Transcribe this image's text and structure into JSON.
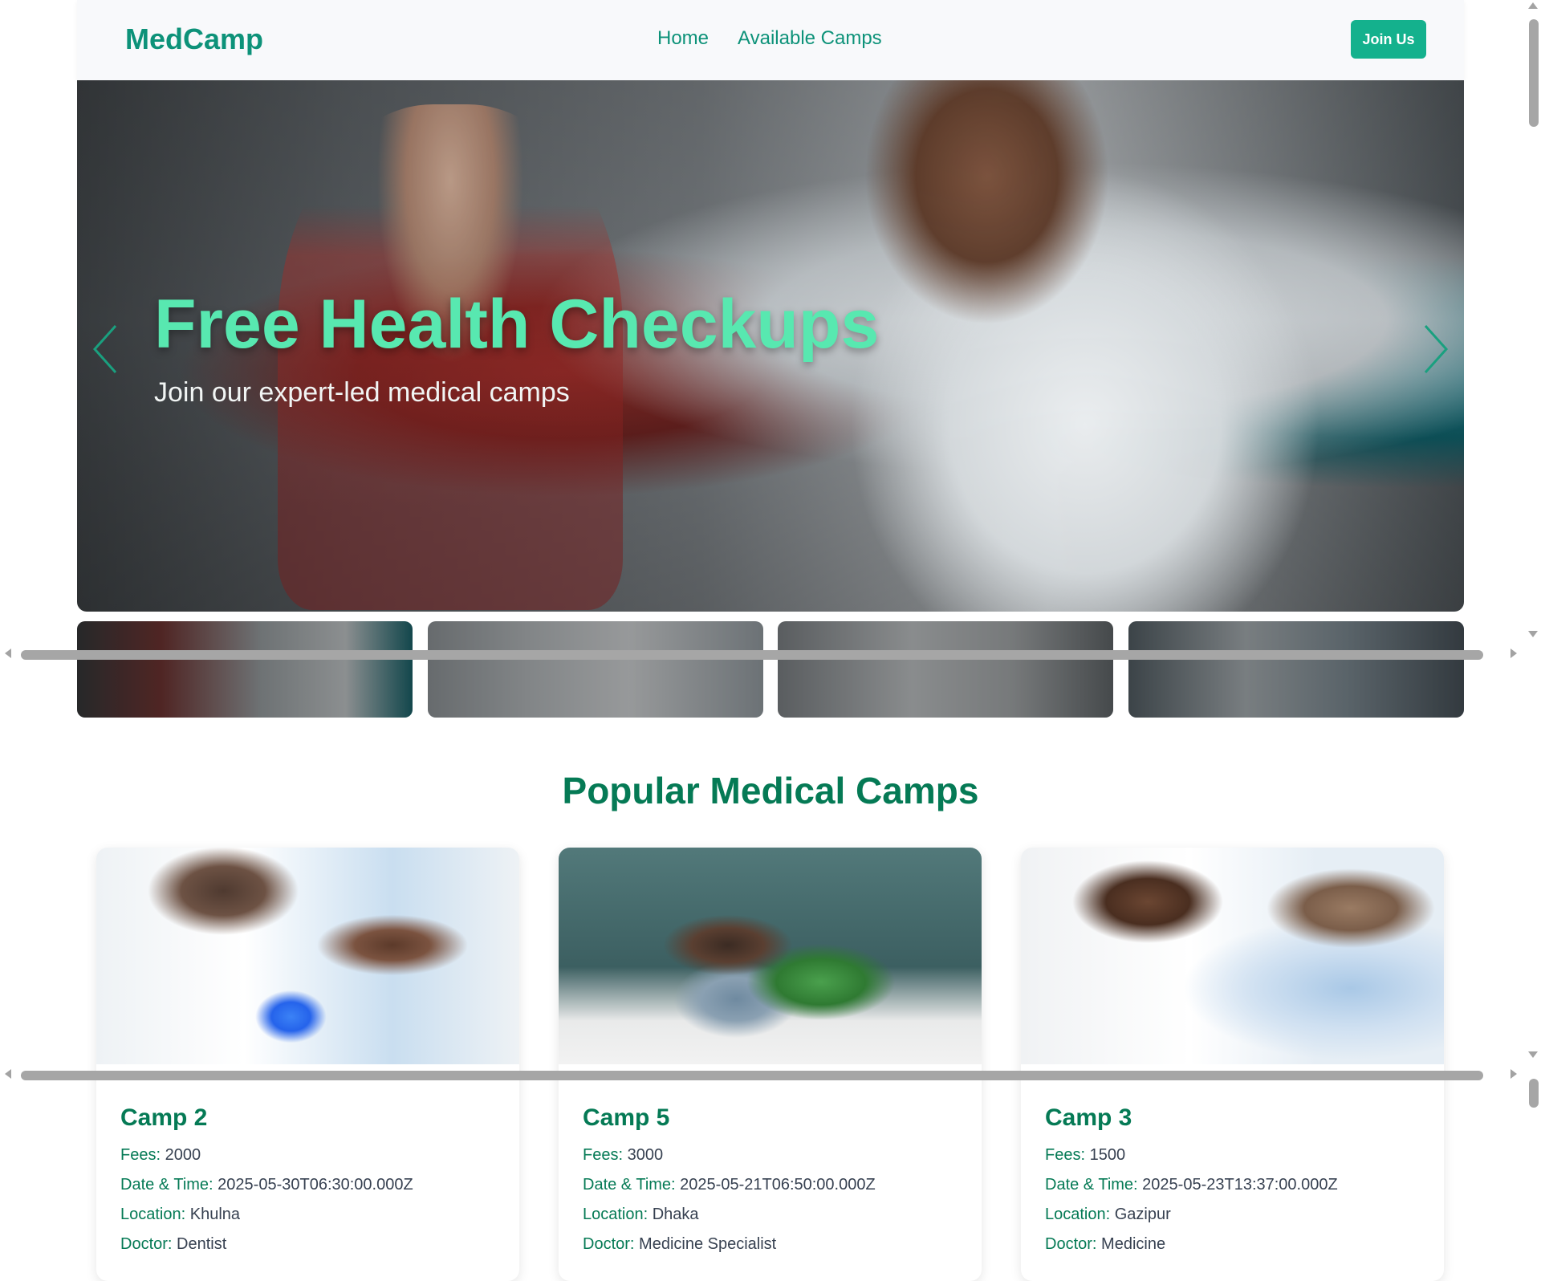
{
  "nav": {
    "brand": "MedCamp",
    "links": [
      "Home",
      "Available Camps"
    ],
    "join_label": "Join Us"
  },
  "hero": {
    "title": "Free Health Checkups",
    "subtitle": "Join our expert-led medical camps"
  },
  "section": {
    "title": "Popular Medical Camps"
  },
  "camps": [
    {
      "name": "Camp 2",
      "fees_label": "Fees:",
      "fees": "2000",
      "datetime_label": "Date & Time:",
      "datetime": "2025-05-30T06:30:00.000Z",
      "location_label": "Location:",
      "location": "Khulna",
      "doctor_label": "Doctor:",
      "doctor": "Dentist"
    },
    {
      "name": "Camp 5",
      "fees_label": "Fees:",
      "fees": "3000",
      "datetime_label": "Date & Time:",
      "datetime": "2025-05-21T06:50:00.000Z",
      "location_label": "Location:",
      "location": "Dhaka",
      "doctor_label": "Doctor:",
      "doctor": "Medicine Specialist"
    },
    {
      "name": "Camp 3",
      "fees_label": "Fees:",
      "fees": "1500",
      "datetime_label": "Date & Time:",
      "datetime": "2025-05-23T13:37:00.000Z",
      "location_label": "Location:",
      "location": "Gazipur",
      "doctor_label": "Doctor:",
      "doctor": "Medicine"
    }
  ],
  "colors": {
    "brand": "#0d9279",
    "accent_button": "#14b18d",
    "hero_title": "#58e8b0",
    "section_title": "#057a55"
  },
  "icons": {
    "hero_prev": "chevron-left-icon",
    "hero_next": "chevron-right-icon"
  }
}
